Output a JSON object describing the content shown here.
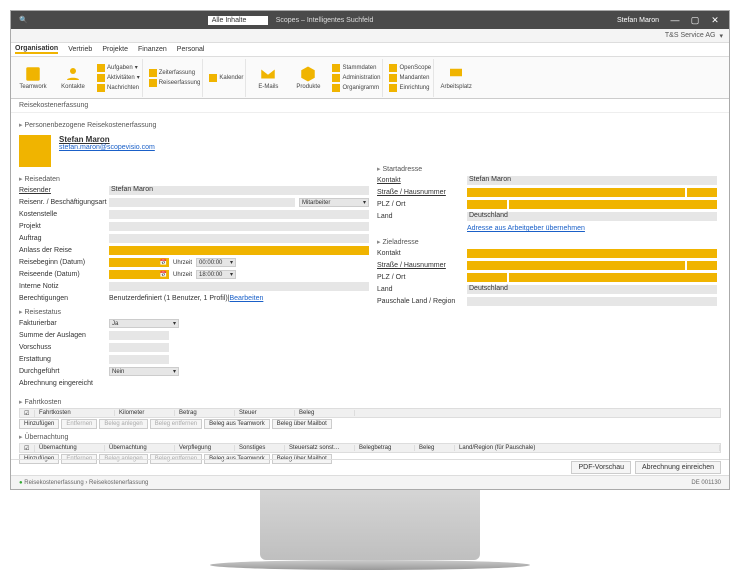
{
  "titlebar": {
    "search_label": "Alle Inhalte",
    "brand": "Scopes – Intelligentes Suchfeld",
    "user": "Stefan Maron"
  },
  "subbar": {
    "company": "T&S Service AG"
  },
  "tabs": [
    "Organisation",
    "Vertrieb",
    "Projekte",
    "Finanzen",
    "Personal"
  ],
  "ribbon": {
    "teamwork": "Teamwork",
    "kontakte": "Kontakte",
    "aufgaben": "Aufgaben",
    "aktivitaeten": "Aktivitäten",
    "nachrichten": "Nachrichten",
    "zeiterfassung": "Zeiterfassung",
    "reiseerfassung": "Reiseerfassung",
    "kalender": "Kalender",
    "emails": "E-Mails",
    "produkte": "Produkte",
    "stammdaten": "Stammdaten",
    "administration": "Administration",
    "organigramm": "Organigramm",
    "openscope": "OpenScope",
    "mandanten": "Mandanten",
    "einrichtung": "Einrichtung",
    "arbeitsplatz": "Arbeitsplatz"
  },
  "breadcrumb": "Reisekostenerfassung",
  "person_section": "Personenbezogene Reisekostenerfassung",
  "person": {
    "name": "Stefan Maron",
    "email": "stefan.maron@scopevisio.com"
  },
  "sections": {
    "reisedaten": "Reisedaten",
    "reisestatus": "Reisestatus",
    "fahrtkosten": "Fahrtkosten",
    "uebernachtung": "Übernachtung",
    "startadresse": "Startadresse",
    "zieladresse": "Zieladresse"
  },
  "labels": {
    "reisender": "Reisender",
    "beschaeftigungsart": "Reisenr. / Beschäftigungsart",
    "kostenstelle": "Kostenstelle",
    "projekt": "Projekt",
    "auftrag": "Auftrag",
    "anlass": "Anlass der Reise",
    "reisebeginn": "Reisebeginn (Datum)",
    "reiseende": "Reiseende (Datum)",
    "uhrzeit": "Uhrzeit",
    "interne_notiz": "Interne Notiz",
    "berechtigungen": "Berechtigungen",
    "fakturierbar": "Fakturierbar",
    "summe": "Summe der Auslagen",
    "vorschuss": "Vorschuss",
    "erstattung": "Erstattung",
    "durchgefuehrt": "Durchgeführt",
    "abrechnung_eingereicht": "Abrechnung eingereicht",
    "kontakt": "Kontakt",
    "strasse": "Straße / Hausnummer",
    "plz": "PLZ / Ort",
    "land": "Land",
    "adresse_uebernehmen": "Adresse aus Arbeitgeber übernehmen",
    "pauschale": "Pauschale Land / Region"
  },
  "values": {
    "reisender": "Stefan Maron",
    "beschaeftigungsart": "Mitarbeiter",
    "uhrzeit_begin": "00:00:00",
    "uhrzeit_ende": "18:00:00",
    "berechtigungen": "Benutzerdefiniert (1 Benutzer, 1 Profil)",
    "bearbeiten": "Bearbeiten",
    "fakturierbar": "Ja",
    "durchgefuehrt": "Nein",
    "start_kontakt": "Stefan Maron",
    "land": "Deutschland"
  },
  "fahrt_cols": [
    "Fahrtkosten",
    "Kilometer",
    "Betrag",
    "Steuer",
    "Beleg"
  ],
  "ueber_cols": [
    "Übernachtung",
    "Übernachtung",
    "Verpflegung",
    "Sonstiges",
    "Steuersatz sonst…",
    "Belegbetrag",
    "Beleg",
    "Land/Region (für Pauschale)"
  ],
  "buttons": {
    "hinzufuegen": "Hinzufügen",
    "entfernen": "Entfernen",
    "beleg_anlegen": "Beleg anlegen",
    "beleg_entfernen": "Beleg entfernen",
    "beleg_teamwork": "Beleg aus Teamwork",
    "beleg_mailbot": "Beleg über Mailbot",
    "pdf": "PDF-Vorschau",
    "einreichen": "Abrechnung einreichen"
  },
  "status_path": "Reisekostenerfassung  ›  Reisekostenerfassung",
  "status_right": "DE 001130"
}
